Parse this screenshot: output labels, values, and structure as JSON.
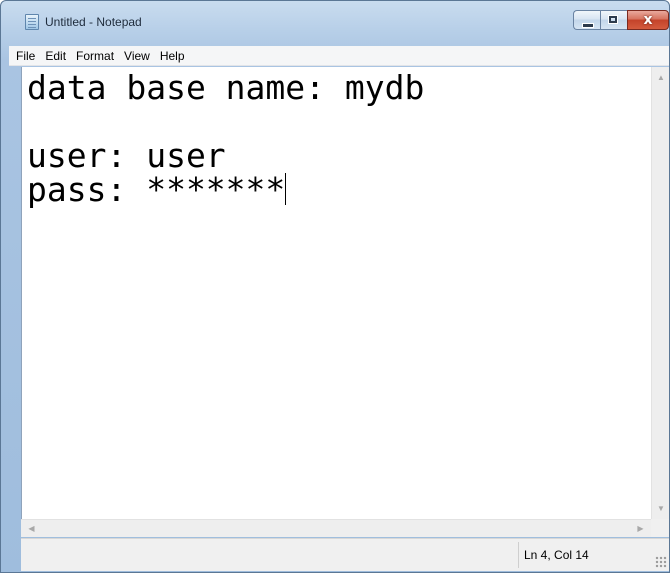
{
  "window": {
    "title": "Untitled - Notepad",
    "close_glyph": "x"
  },
  "menubar": {
    "items": [
      "File",
      "Edit",
      "Format",
      "View",
      "Help"
    ]
  },
  "editor": {
    "lines": [
      "data base name: mydb",
      "",
      "user: user",
      "pass: *******"
    ]
  },
  "statusbar": {
    "position": "Ln 4, Col 14"
  },
  "icons": {
    "app": "notepad-icon",
    "minimize": "minimize-icon",
    "maximize": "maximize-icon",
    "close": "close-icon"
  },
  "colors": {
    "frame": "#b7cfe8",
    "close_button": "#c4432a"
  }
}
